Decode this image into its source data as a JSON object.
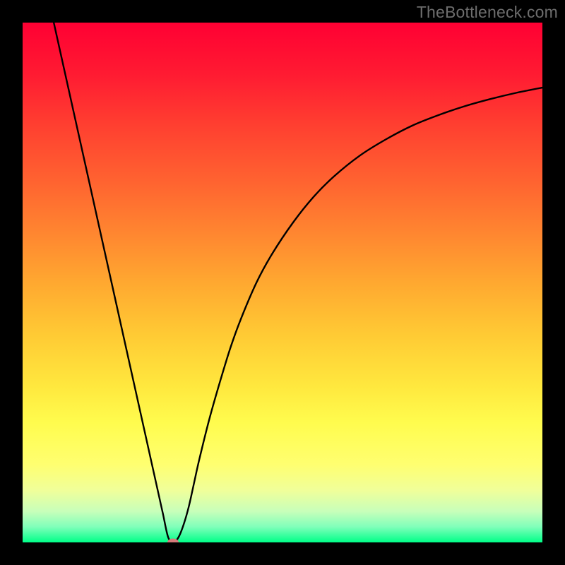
{
  "watermark": "TheBottleneck.com",
  "chart_data": {
    "type": "line",
    "title": "",
    "xlabel": "",
    "ylabel": "",
    "xlim": [
      0,
      100
    ],
    "ylim": [
      0,
      100
    ],
    "grid": false,
    "legend": false,
    "background_gradient": {
      "stops": [
        {
          "pos": 0.0,
          "color": "#ff0033"
        },
        {
          "pos": 0.1,
          "color": "#ff1b32"
        },
        {
          "pos": 0.2,
          "color": "#ff4030"
        },
        {
          "pos": 0.3,
          "color": "#ff6130"
        },
        {
          "pos": 0.4,
          "color": "#ff8430"
        },
        {
          "pos": 0.5,
          "color": "#ffa830"
        },
        {
          "pos": 0.6,
          "color": "#ffca34"
        },
        {
          "pos": 0.7,
          "color": "#ffe83e"
        },
        {
          "pos": 0.77,
          "color": "#fffc4e"
        },
        {
          "pos": 0.85,
          "color": "#ffff70"
        },
        {
          "pos": 0.9,
          "color": "#f0ff9a"
        },
        {
          "pos": 0.94,
          "color": "#c8ffba"
        },
        {
          "pos": 0.97,
          "color": "#80ffba"
        },
        {
          "pos": 1.0,
          "color": "#00ff88"
        }
      ]
    },
    "series": [
      {
        "name": "bottleneck-curve",
        "color": "#000000",
        "x": [
          6,
          8,
          10,
          12,
          14,
          16,
          18,
          20,
          22,
          24,
          26,
          27,
          28,
          29,
          30,
          31,
          32,
          33,
          34,
          36,
          38,
          40,
          42,
          45,
          48,
          52,
          56,
          60,
          65,
          70,
          75,
          80,
          85,
          90,
          95,
          100
        ],
        "y": [
          100,
          91,
          82,
          73,
          64,
          55,
          46,
          37,
          28,
          19,
          10,
          5.5,
          1,
          0,
          1,
          3.5,
          7,
          11.5,
          16,
          24,
          31,
          37.5,
          43,
          50,
          55.5,
          61.5,
          66.5,
          70.5,
          74.5,
          77.6,
          80.2,
          82.2,
          83.9,
          85.3,
          86.5,
          87.5
        ]
      }
    ],
    "minimum_point": {
      "x": 29,
      "y": 0,
      "color": "#d47a7a"
    }
  }
}
